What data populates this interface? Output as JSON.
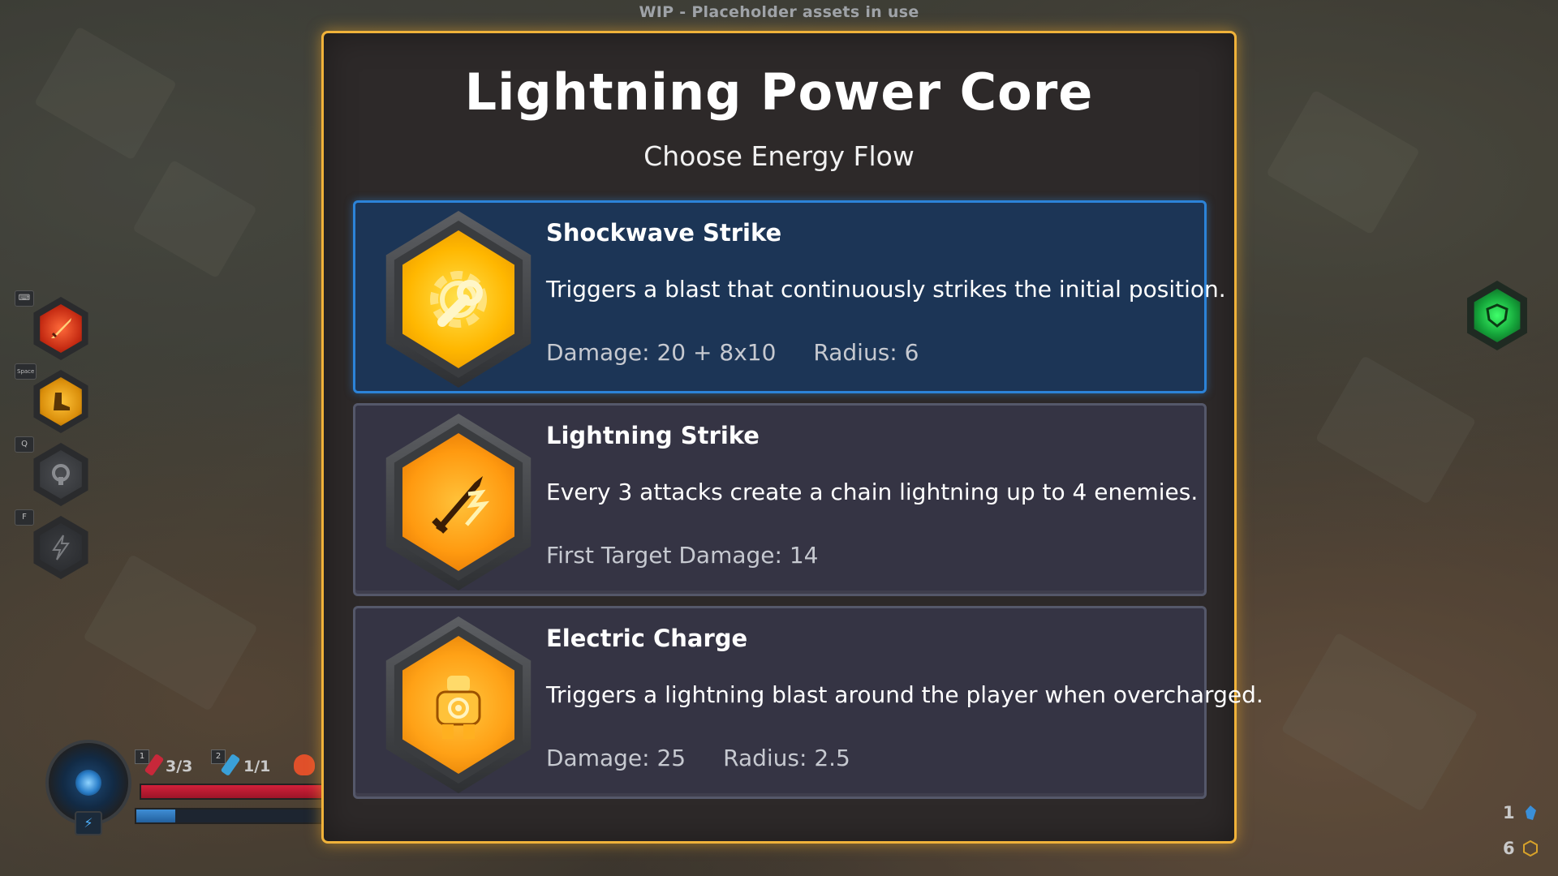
{
  "banner": {
    "wip_text": "WIP - Placeholder assets in use"
  },
  "panel": {
    "title": "Lightning Power Core",
    "subtitle": "Choose Energy Flow",
    "options": [
      {
        "name": "Shockwave Strike",
        "description": "Triggers a blast that continuously strikes the initial position.",
        "stats": [
          "Damage: 20 + 8x10",
          "Radius: 6"
        ],
        "icon": "wrench-gear-icon",
        "selected": true
      },
      {
        "name": "Lightning Strike",
        "description": "Every 3 attacks create a chain lightning up to 4 enemies.",
        "stats": [
          "First Target Damage: 14"
        ],
        "icon": "lightning-sword-icon",
        "selected": false
      },
      {
        "name": "Electric Charge",
        "description": "Triggers a lightning blast around the player when overcharged.",
        "stats": [
          "Damage: 25",
          "Radius: 2.5"
        ],
        "icon": "charged-robot-icon",
        "selected": false
      }
    ]
  },
  "hud": {
    "skills": [
      {
        "key": "",
        "icon": "flaming-sword-icon"
      },
      {
        "key": "Space",
        "icon": "dash-boot-icon"
      },
      {
        "key": "Q",
        "icon": "shield-gear-icon"
      },
      {
        "key": "F",
        "icon": "lightning-icon"
      }
    ],
    "slots": [
      {
        "key": "1",
        "count": "3/3",
        "icon": "red-potion-icon"
      },
      {
        "key": "2",
        "count": "1/1",
        "icon": "blue-syringe-icon"
      }
    ],
    "health_fraction": 1.0,
    "energy_fraction": 0.2,
    "resources": [
      {
        "count": "1",
        "icon": "blue-crystal-icon"
      },
      {
        "count": "6",
        "icon": "gold-hex-icon"
      }
    ],
    "colors": {
      "accent": "#f0b23a",
      "selected": "#2c83d8",
      "health": "#d2203a",
      "energy": "#3f8ed6"
    }
  }
}
